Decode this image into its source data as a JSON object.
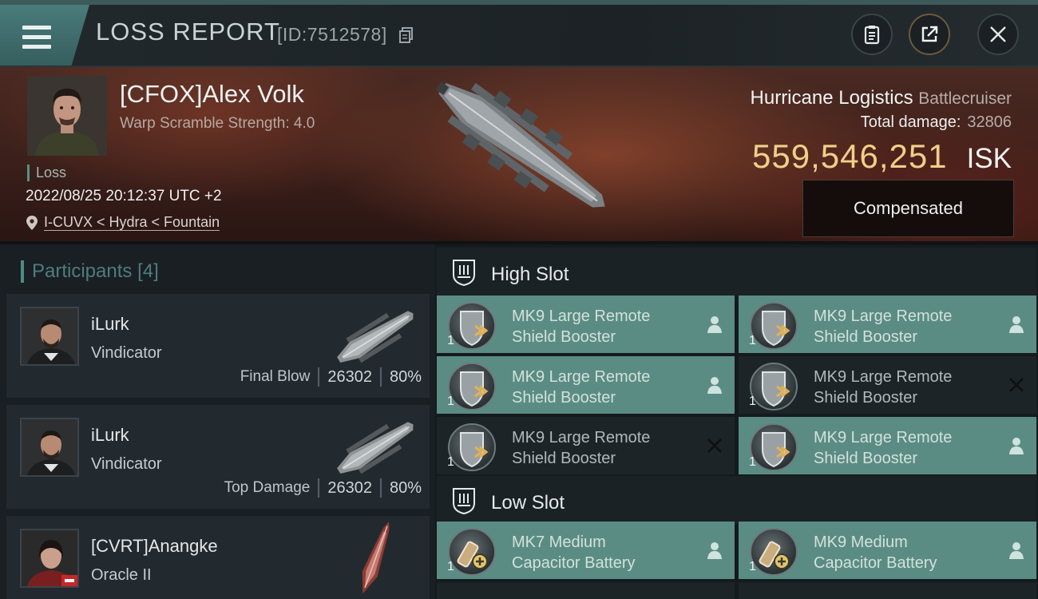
{
  "header": {
    "title": "LOSS REPORT",
    "report_id": "[ID:7512578]"
  },
  "victim": {
    "name": "[CFOX]Alex Volk",
    "warp_scramble": "Warp Scramble Strength: 4.0",
    "status": "Loss",
    "timestamp": "2022/08/25 20:12:37 UTC +2",
    "location": "I-CUVX < Hydra < Fountain",
    "ship_name": "Hurricane Logistics",
    "ship_class": "Battlecruiser",
    "total_damage_label": "Total damage:",
    "total_damage": "32806",
    "isk_value": "559,546,251",
    "isk_unit": "ISK",
    "compensated_label": "Compensated"
  },
  "participants": {
    "title": "Participants",
    "count": "[4]",
    "list": [
      {
        "name": "iLurk",
        "ship": "Vindicator",
        "role": "Final Blow",
        "damage": "26302",
        "percent": "80%"
      },
      {
        "name": "iLurk",
        "ship": "Vindicator",
        "role": "Top Damage",
        "damage": "26302",
        "percent": "80%"
      },
      {
        "name": "[CVRT]Anangke",
        "ship": "Oracle II"
      }
    ]
  },
  "fitting": {
    "high_slot_label": "High Slot",
    "low_slot_label": "Low Slot",
    "high_slots": [
      {
        "line1": "MK9 Large Remote",
        "line2": "Shield Booster",
        "qty": "1",
        "state": "fitted"
      },
      {
        "line1": "MK9 Large Remote",
        "line2": "Shield Booster",
        "qty": "1",
        "state": "fitted"
      },
      {
        "line1": "MK9 Large Remote",
        "line2": "Shield Booster",
        "qty": "1",
        "state": "fitted"
      },
      {
        "line1": "MK9 Large Remote",
        "line2": "Shield Booster",
        "qty": "1",
        "state": "destroyed"
      },
      {
        "line1": "MK9 Large Remote",
        "line2": "Shield Booster",
        "qty": "1",
        "state": "destroyed"
      },
      {
        "line1": "MK9 Large Remote",
        "line2": "Shield Booster",
        "qty": "1",
        "state": "fitted"
      }
    ],
    "low_slots": [
      {
        "line1": "MK7 Medium",
        "line2": "Capacitor Battery",
        "qty": "1",
        "state": "fitted"
      },
      {
        "line1": "MK9 Medium",
        "line2": "Capacitor Battery",
        "qty": "1",
        "state": "fitted"
      }
    ]
  },
  "colors": {
    "accent_teal": "#5b8c83",
    "isk_gold": "#f0cf8a"
  },
  "icons": {
    "menu": "hamburger-icon",
    "copy": "copy-icon",
    "clipboard": "clipboard-icon",
    "share": "share-icon",
    "close": "close-icon",
    "location": "map-pin-icon",
    "slot_section": "slot-rack-icon",
    "dropped": "person-icon",
    "destroyed": "x-icon"
  }
}
